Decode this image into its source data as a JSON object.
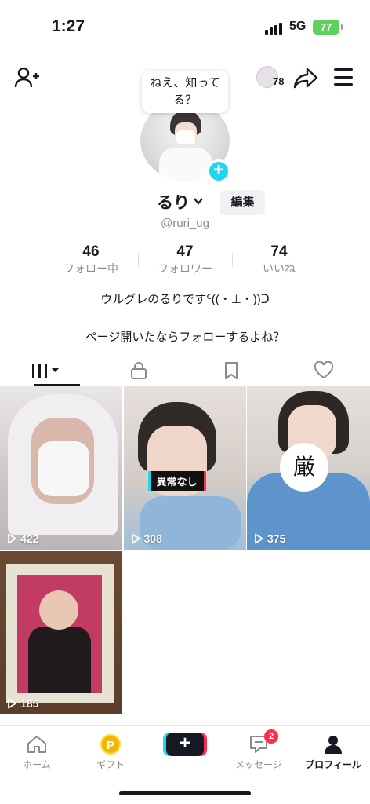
{
  "status_bar": {
    "time": "1:27",
    "network": "5G",
    "battery": "77"
  },
  "header": {
    "visitor_count": "78"
  },
  "profile": {
    "bubble_text": "ねえ、知ってる？",
    "name": "るり",
    "edit_label": "編集",
    "handle": "@ruri_ug",
    "stats": [
      {
        "value": "46",
        "label": "フォロー中"
      },
      {
        "value": "47",
        "label": "フォロワー"
      },
      {
        "value": "74",
        "label": "いいね"
      }
    ],
    "bio_line1": "ウルグレのるりですᑦ((・⊥・))ᑐ",
    "bio_line2": "ページ開いたならフォローするよね？"
  },
  "videos": [
    {
      "views": "422"
    },
    {
      "views": "308",
      "caption": "異常なし"
    },
    {
      "views": "375",
      "badge": "厳"
    },
    {
      "views": "185"
    }
  ],
  "bottom_nav": {
    "home": "ホーム",
    "gift": "ギフト",
    "gift_coin": "P",
    "create": "+",
    "inbox": "メッセージ",
    "inbox_badge": "2",
    "profile": "プロフィール"
  },
  "colors": {
    "accent_cyan": "#20d5ec",
    "accent_red": "#fe2c55",
    "battery_green": "#5fd05f"
  }
}
